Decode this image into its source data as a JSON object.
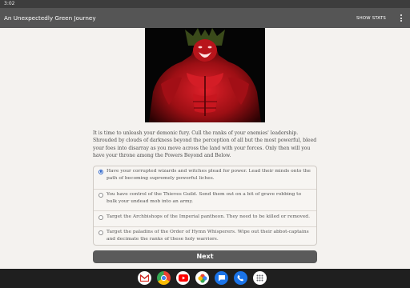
{
  "status_bar": {
    "time": "3:02"
  },
  "app_bar": {
    "title": "An Unexpectedly Green Journey",
    "show_stats": "SHOW STATS"
  },
  "story": {
    "intro": "It is time to unleash your demonic fury. Cull the ranks of your enemies' leadership. Shrouded by clouds of darkness beyond the perception of all but the most powerful, bleed your foes into disarray as you move across the land with your forces. Only then will you have your throne among the Powers Beyond and Below."
  },
  "options": [
    {
      "text": "Have your corrupted wizards and witches plead for power. Lead their minds onto the path of becoming supremely powerful liches.",
      "selected": true
    },
    {
      "text": "You have control of the Thieves Guild. Send them out on a bit of grave robbing to bulk your undead mob into an army.",
      "selected": false
    },
    {
      "text": "Target the Archbishops of the Imperial pantheon. They need to be killed or removed.",
      "selected": false
    },
    {
      "text": "Target the paladins of the Order of Hymn Whisperers. Wipe out their abbot-captains and decimate the ranks of these holy warriors.",
      "selected": false
    }
  ],
  "next_button": {
    "label": "Next"
  },
  "dock": {
    "apps": [
      "gmail-icon",
      "chrome-icon",
      "youtube-icon",
      "photos-icon",
      "messages-icon",
      "phone-icon",
      "app-drawer-icon"
    ]
  },
  "colors": {
    "app_bar": "#555555",
    "background": "#f4f2ef",
    "radio_selected": "#2b63c9",
    "button": "#5a5a5a"
  }
}
